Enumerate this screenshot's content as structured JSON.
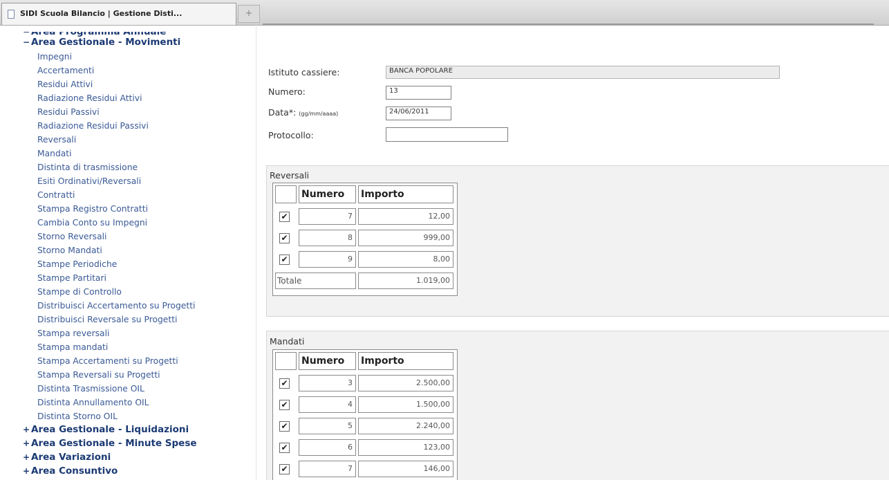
{
  "browser": {
    "tab_title": "SIDI Scuola Bilancio | Gestione Disti...",
    "newtab_icon": "+"
  },
  "sidebar": {
    "top_cut_section": "Area Programma Annuale",
    "expanded_section": "Area Gestionale - Movimenti",
    "expanded_symbol": "−",
    "items": [
      "Impegni",
      "Accertamenti",
      "Residui Attivi",
      "Radiazione Residui Attivi",
      "Residui Passivi",
      "Radiazione Residui Passivi",
      "Reversali",
      "Mandati",
      "Distinta di trasmissione",
      "Esiti Ordinativi/Reversali",
      "Contratti",
      "Stampa Registro Contratti",
      "Cambia Conto su Impegni",
      "Storno Reversali",
      "Storno Mandati",
      "Stampe Periodiche",
      "Stampe Partitari",
      "Stampe di Controllo",
      "Distribuisci Accertamento su Progetti",
      "Distribuisci Reversale su Progetti",
      "Stampa reversali",
      "Stampa mandati",
      "Stampa Accertamenti su Progetti",
      "Stampa Reversali su Progetti",
      "Distinta Trasmissione OIL",
      "Distinta Annullamento OIL",
      "Distinta Storno OIL"
    ],
    "collapsed_symbol": "+",
    "collapsed_sections": [
      "Area Gestionale - Liquidazioni",
      "Area Gestionale - Minute Spese",
      "Area Variazioni",
      "Area Consuntivo"
    ]
  },
  "form": {
    "istituto_label": "Istituto cassiere:",
    "istituto_value": "BANCA POPOLARE",
    "numero_label": "Numero:",
    "numero_value": "13",
    "data_label": "Data*:",
    "data_hint": "(gg/mm/aaaa)",
    "data_value": "24/06/2011",
    "protocollo_label": "Protocollo:",
    "protocollo_value": ""
  },
  "reversali": {
    "title": "Reversali",
    "col_numero": "Numero",
    "col_importo": "Importo",
    "rows": [
      {
        "numero": "7",
        "importo": "12,00",
        "checked": true
      },
      {
        "numero": "8",
        "importo": "999,00",
        "checked": true
      },
      {
        "numero": "9",
        "importo": "8,00",
        "checked": true
      }
    ],
    "totale_label": "Totale",
    "totale_value": "1.019,00"
  },
  "mandati": {
    "title": "Mandati",
    "col_numero": "Numero",
    "col_importo": "Importo",
    "rows": [
      {
        "numero": "3",
        "importo": "2.500,00",
        "checked": true
      },
      {
        "numero": "4",
        "importo": "1.500,00",
        "checked": true
      },
      {
        "numero": "5",
        "importo": "2.240,00",
        "checked": true
      },
      {
        "numero": "6",
        "importo": "123,00",
        "checked": true
      },
      {
        "numero": "7",
        "importo": "146,00",
        "checked": true
      }
    ]
  },
  "check_glyph": "✔"
}
